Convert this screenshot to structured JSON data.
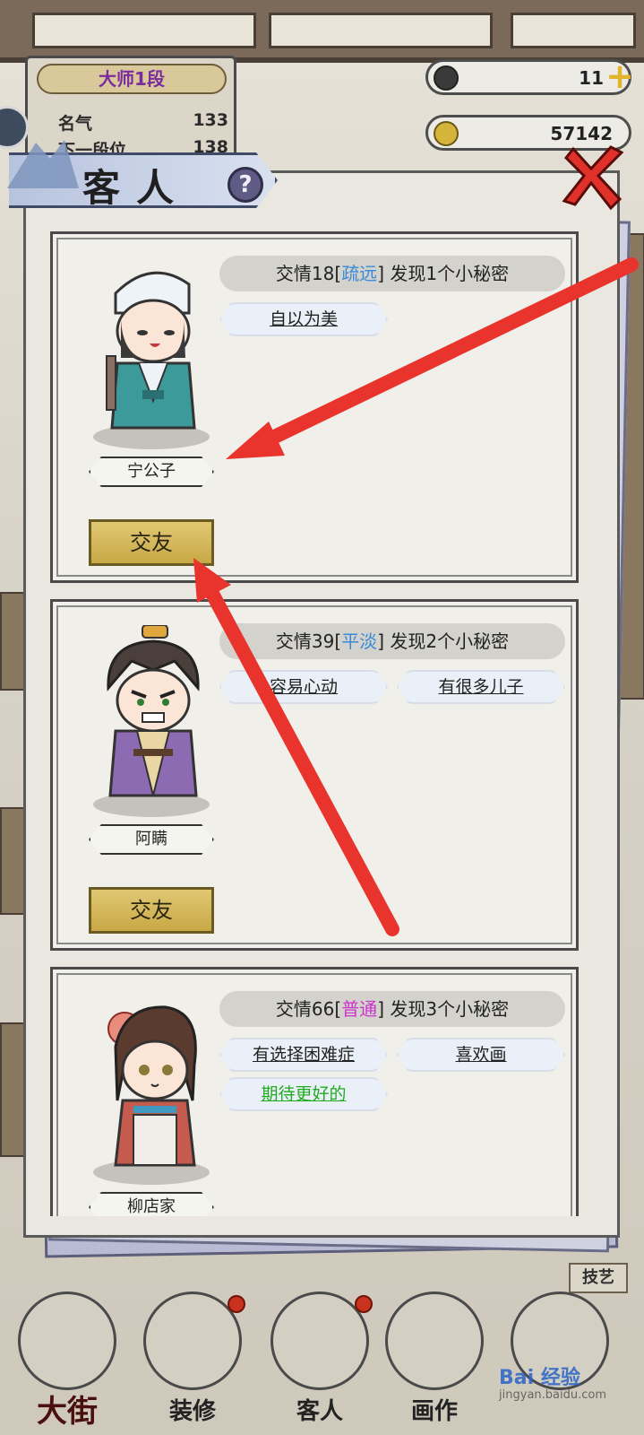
{
  "rank": {
    "title": "大师1段",
    "rows": [
      {
        "label": "名气",
        "value": "133"
      },
      {
        "label": "下一段位",
        "value": "138"
      }
    ]
  },
  "currencies": {
    "jade": "11",
    "coins": "57142"
  },
  "dialog": {
    "title": "客人",
    "help_icon": "?"
  },
  "guests": [
    {
      "name": "宁公子",
      "intimacy_prefix": "交情18[",
      "level": "疏远",
      "intimacy_suffix": "] 发现1个小秘密",
      "traits": [
        "自以为美"
      ],
      "button": "交友"
    },
    {
      "name": "阿瞒",
      "intimacy_prefix": "交情39[",
      "level": "平淡",
      "intimacy_suffix": "] 发现2个小秘密",
      "traits": [
        "容易心动",
        "有很多儿子"
      ],
      "button": "交友"
    },
    {
      "name": "柳店家",
      "intimacy_prefix": "交情66[",
      "level": "普通",
      "intimacy_suffix": "] 发现3个小秘密",
      "traits": [
        "有选择困难症",
        "喜欢画",
        "期待更好的"
      ]
    }
  ],
  "nav": {
    "skills": "技艺",
    "items": [
      "大街",
      "装修",
      "客人",
      "画作"
    ]
  },
  "watermark": {
    "brand": "Bai 经验",
    "url": "jingyan.baidu.com"
  },
  "colors": {
    "level_blue": "#3b8ad9",
    "level_magenta": "#cc33cc",
    "trait_green": "#22aa22",
    "arrow_red": "#e8342c"
  }
}
